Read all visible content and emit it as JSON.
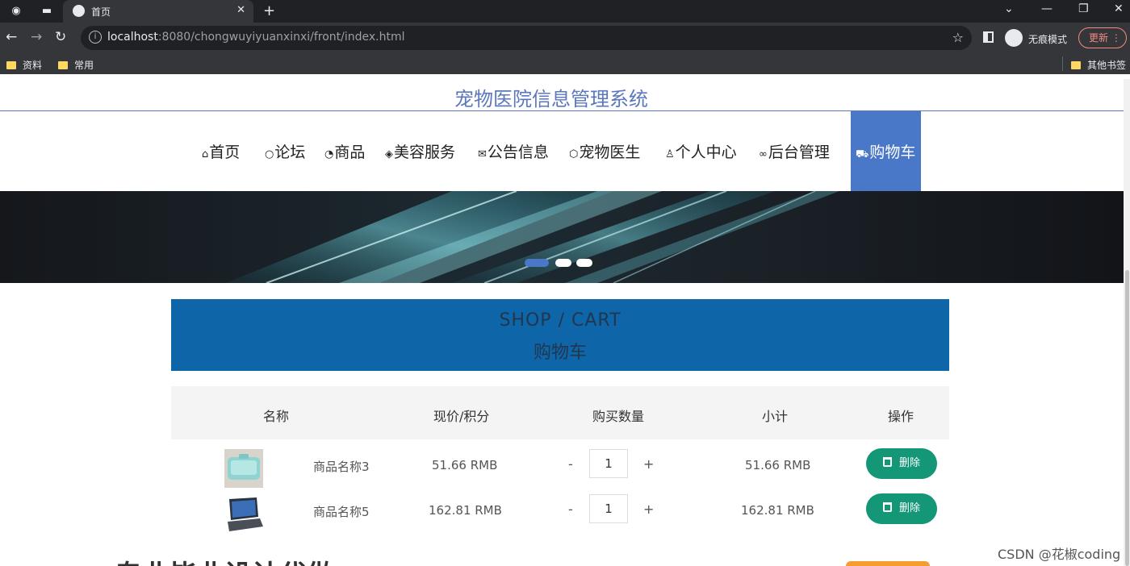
{
  "browser": {
    "tab_title": "首页",
    "url_host": "localhost",
    "url_rest": ":8080/chongwuyiyuanxinxi/front/index.html",
    "incognito_label": "无痕模式",
    "update_label": "更新",
    "bookmarks": [
      "资料",
      "常用"
    ],
    "other_bookmarks": "其他书签"
  },
  "site": {
    "title": "宠物医院信息管理系统",
    "nav": [
      {
        "icon": "home-icon",
        "label": "首页"
      },
      {
        "icon": "forum-icon",
        "label": "论坛"
      },
      {
        "icon": "goods-icon",
        "label": "商品"
      },
      {
        "icon": "beauty-icon",
        "label": "美容服务"
      },
      {
        "icon": "mail-icon",
        "label": "公告信息"
      },
      {
        "icon": "doctor-icon",
        "label": "宠物医生"
      },
      {
        "icon": "user-icon",
        "label": "个人中心"
      },
      {
        "icon": "link-icon",
        "label": "后台管理"
      },
      {
        "icon": "cart-icon",
        "label": "购物车"
      }
    ],
    "active_nav": "购物车"
  },
  "cart": {
    "header_en": "SHOP / CART",
    "header_cn": "购物车",
    "columns": [
      "名称",
      "现价/积分",
      "购买数量",
      "小计",
      "操作"
    ],
    "items": [
      {
        "name": "商品名称3",
        "price": "51.66 RMB",
        "qty": "1",
        "subtotal": "51.66 RMB",
        "delete_label": "删除"
      },
      {
        "name": "商品名称5",
        "price": "162.81 RMB",
        "qty": "1",
        "subtotal": "162.81 RMB",
        "delete_label": "删除"
      }
    ],
    "qty_minus": "-",
    "qty_plus": "+"
  },
  "footer": {
    "partial_text": "专业毕业设计代做"
  },
  "watermark": "CSDN @花椒coding",
  "colors": {
    "brand_blue": "#4a78c9",
    "cart_header": "#0e66a8",
    "delete_green": "#139776"
  }
}
